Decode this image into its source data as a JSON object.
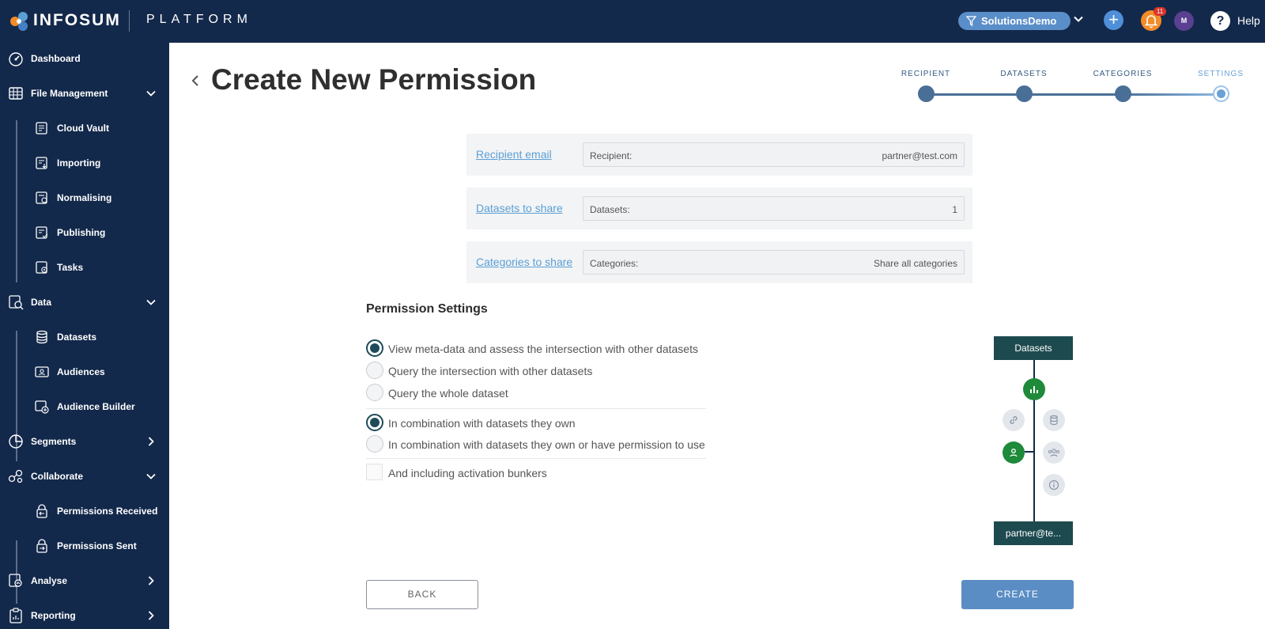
{
  "topbar": {
    "brand": "INFOSUM",
    "product": "PLATFORM",
    "workspace": "SolutionsDemo",
    "notification_count": "11",
    "avatar_initial": "M",
    "help_label": "Help",
    "colors": {
      "bar": "#13294b",
      "workspace_pill": "#5a8ec8",
      "bell": "#f28c28",
      "avatar": "#5b3f91"
    }
  },
  "sidebar": {
    "items": [
      {
        "label": "Dashboard",
        "icon": "dashboard-icon"
      },
      {
        "label": "File Management",
        "icon": "file-management-icon",
        "expanded": true
      },
      {
        "label": "Cloud Vault",
        "icon": "cloud-vault-icon",
        "sub": true
      },
      {
        "label": "Importing",
        "icon": "importing-icon",
        "sub": true
      },
      {
        "label": "Normalising",
        "icon": "normalising-icon",
        "sub": true
      },
      {
        "label": "Publishing",
        "icon": "publishing-icon",
        "sub": true
      },
      {
        "label": "Tasks",
        "icon": "tasks-icon",
        "sub": true
      },
      {
        "label": "Data",
        "icon": "data-icon",
        "expanded": true
      },
      {
        "label": "Datasets",
        "icon": "datasets-icon",
        "sub": true
      },
      {
        "label": "Audiences",
        "icon": "audiences-icon",
        "sub": true
      },
      {
        "label": "Audience Builder",
        "icon": "audience-builder-icon",
        "sub": true
      },
      {
        "label": "Segments",
        "icon": "segments-icon",
        "expanded": false
      },
      {
        "label": "Collaborate",
        "icon": "collaborate-icon",
        "expanded": true
      },
      {
        "label": "Permissions Received",
        "icon": "permissions-received-icon",
        "sub": true
      },
      {
        "label": "Permissions Sent",
        "icon": "permissions-sent-icon",
        "sub": true
      },
      {
        "label": "Analyse",
        "icon": "analyse-icon",
        "expanded": false
      },
      {
        "label": "Reporting",
        "icon": "reporting-icon",
        "expanded": false
      }
    ]
  },
  "page": {
    "title": "Create New Permission"
  },
  "stepper": {
    "steps": [
      "RECIPIENT",
      "DATASETS",
      "CATEGORIES",
      "SETTINGS"
    ],
    "current": 3
  },
  "summary": [
    {
      "link": "Recipient email",
      "field_label": "Recipient:",
      "field_value": "partner@test.com"
    },
    {
      "link": "Datasets to share",
      "field_label": "Datasets:",
      "field_value": "1"
    },
    {
      "link": "Categories to share",
      "field_label": "Categories:",
      "field_value": "Share all categories"
    }
  ],
  "settings": {
    "heading": "Permission Settings",
    "access_options": [
      {
        "label": "View meta-data and assess the intersection with other datasets",
        "selected": true
      },
      {
        "label": "Query the intersection with other datasets",
        "selected": false
      },
      {
        "label": "Query the whole dataset",
        "selected": false
      }
    ],
    "scope_options": [
      {
        "label": "In combination with datasets they own",
        "selected": true
      },
      {
        "label": "In combination with datasets they own or have permission to use",
        "selected": false
      }
    ],
    "bunkers_checkbox": {
      "label": "And including activation bunkers",
      "checked": false
    }
  },
  "diagram": {
    "top_box": "Datasets",
    "bottom_box": "partner@te...",
    "nodes": [
      "chart-icon",
      "link-icon",
      "database-icon",
      "user-icon",
      "users-icon",
      "info-icon"
    ]
  },
  "actions": {
    "back_label": "BACK",
    "create_label": "CREATE"
  }
}
